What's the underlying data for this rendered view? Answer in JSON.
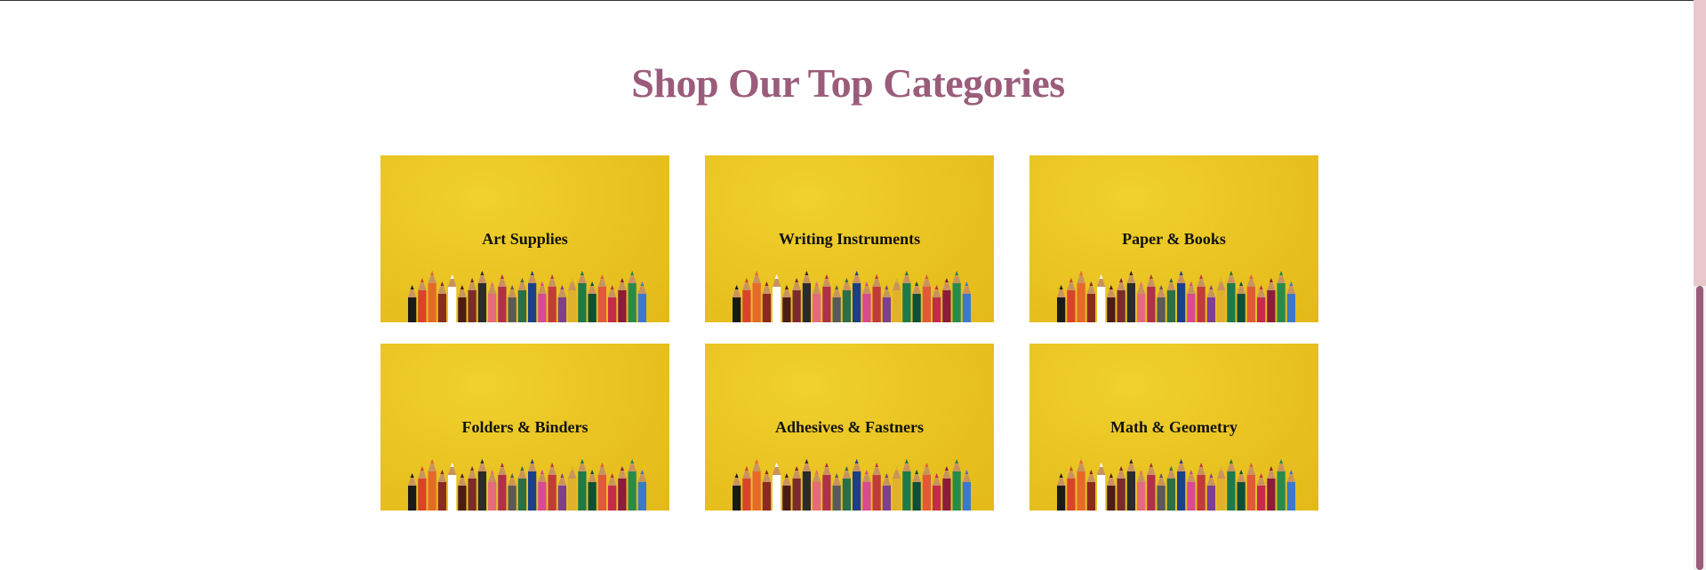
{
  "section": {
    "title": "Shop Our Top Categories"
  },
  "categories": [
    {
      "label": "Art Supplies"
    },
    {
      "label": "Writing Instruments"
    },
    {
      "label": "Paper & Books"
    },
    {
      "label": "Folders & Binders"
    },
    {
      "label": "Adhesives & Fastners"
    },
    {
      "label": "Math & Geometry"
    }
  ],
  "colors": {
    "title": "#9b5c7b",
    "card_background": "#eac523",
    "scrollbar_thumb": "#9b5c7b",
    "scrollbar_track": "#e8c8cc"
  },
  "pencil_colors": [
    "#1a1a1a",
    "#d9432c",
    "#e56a2a",
    "#8b2a1e",
    "#ffffff",
    "#4a1c14",
    "#7a2b2b",
    "#2b2b2b",
    "#e46b7a",
    "#b0304a",
    "#5a5a5a",
    "#2c6e49",
    "#1c3f8a",
    "#d84a91",
    "#c23b3b",
    "#7e3f8f",
    "#e0b12c",
    "#1d7a4a",
    "#0e4f3a",
    "#e05a3a",
    "#c72b4a",
    "#8b1c3a",
    "#2a8a4a",
    "#3b7ac9"
  ]
}
